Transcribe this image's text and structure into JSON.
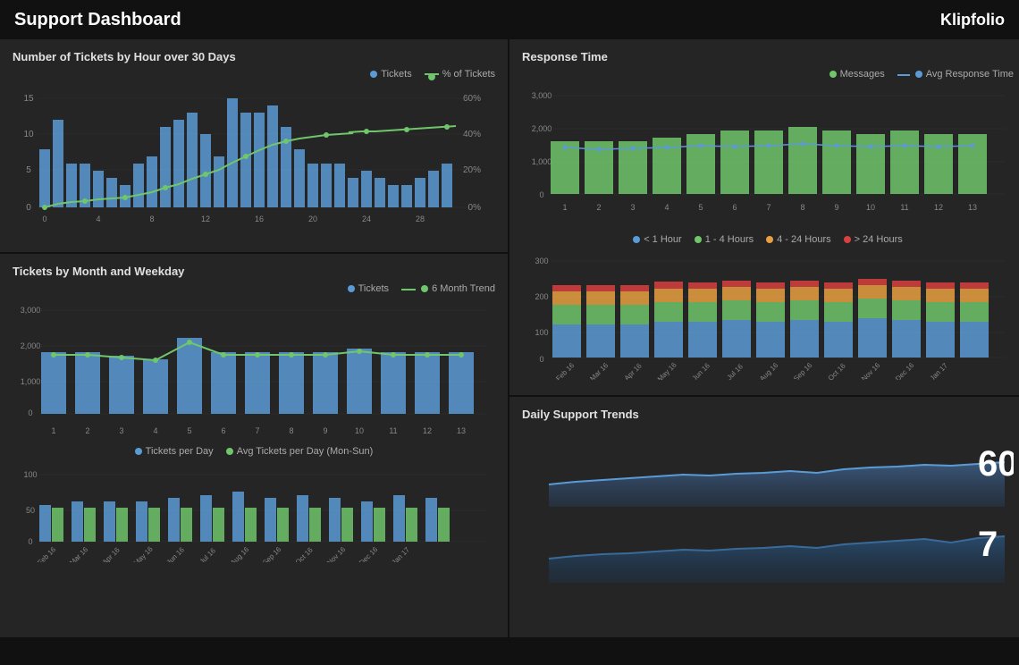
{
  "header": {
    "title": "Support Dashboard",
    "logo": "Klipfolio"
  },
  "panels": {
    "tickets_by_hour": {
      "title": "Number of Tickets by Hour over 30 Days",
      "legend": [
        {
          "label": "Tickets",
          "color": "#5b9bd5",
          "type": "dot"
        },
        {
          "label": "% of Tickets",
          "color": "#70c66b",
          "type": "line-dot"
        }
      ]
    },
    "tickets_by_month": {
      "title": "Tickets by Month and Weekday",
      "legend": [
        {
          "label": "Tickets",
          "color": "#5b9bd5",
          "type": "dot"
        },
        {
          "label": "6 Month Trend",
          "color": "#70c66b",
          "type": "line-dot"
        }
      ],
      "sub_legend": [
        {
          "label": "Tickets per Day",
          "color": "#5b9bd5",
          "type": "dot"
        },
        {
          "label": "Avg Tickets per Day (Mon-Sun)",
          "color": "#70c66b",
          "type": "dot"
        }
      ]
    },
    "response_time": {
      "title": "Response Time",
      "legend": [
        {
          "label": "Messages",
          "color": "#70c66b",
          "type": "dot"
        },
        {
          "label": "Avg Response Time",
          "color": "#5b9bd5",
          "type": "line-dot"
        }
      ],
      "legend2": [
        {
          "label": "< 1 Hour",
          "color": "#5b9bd5",
          "type": "dot"
        },
        {
          "label": "1 - 4 Hours",
          "color": "#70c66b",
          "type": "dot"
        },
        {
          "label": "4 - 24 Hours",
          "color": "#e8a040",
          "type": "dot"
        },
        {
          "label": "> 24 Hours",
          "color": "#d94040",
          "type": "dot"
        }
      ]
    },
    "daily_trends": {
      "title": "Daily Support Trends",
      "values": [
        60,
        7
      ]
    }
  }
}
